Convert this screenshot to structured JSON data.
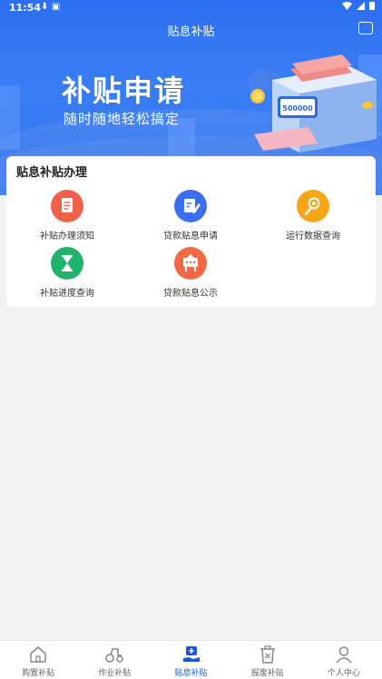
{
  "status_bar": {
    "time": "11:54"
  },
  "header": {
    "title": "贴息补贴"
  },
  "banner": {
    "title": "补贴申请",
    "subtitle": "随时随地轻松搞定",
    "display_number": "500000"
  },
  "card": {
    "title": "贴息补贴办理",
    "items": [
      {
        "label": "补贴办理须知",
        "icon": "document-icon",
        "color": "#f0614a"
      },
      {
        "label": "贷款贴息申请",
        "icon": "edit-form-icon",
        "color": "#3b6ef0"
      },
      {
        "label": "运行数据查询",
        "icon": "location-search-icon",
        "color": "#f5a516"
      },
      {
        "label": "补贴进度查询",
        "icon": "hourglass-icon",
        "color": "#22b36b"
      },
      {
        "label": "贷款贴息公示",
        "icon": "billboard-icon",
        "color": "#f26a45"
      }
    ]
  },
  "tabbar": {
    "tabs": [
      {
        "label": "购置补贴",
        "icon": "home-icon",
        "active": false
      },
      {
        "label": "作业补贴",
        "icon": "tractor-icon",
        "active": false
      },
      {
        "label": "贴息补贴",
        "icon": "subsidy-icon",
        "active": true
      },
      {
        "label": "报废补贴",
        "icon": "scrap-bin-icon",
        "active": false
      },
      {
        "label": "个人中心",
        "icon": "user-icon",
        "active": false
      }
    ]
  },
  "colors": {
    "primary": "#2c6ff0",
    "tab_active": "#1a56d6"
  }
}
